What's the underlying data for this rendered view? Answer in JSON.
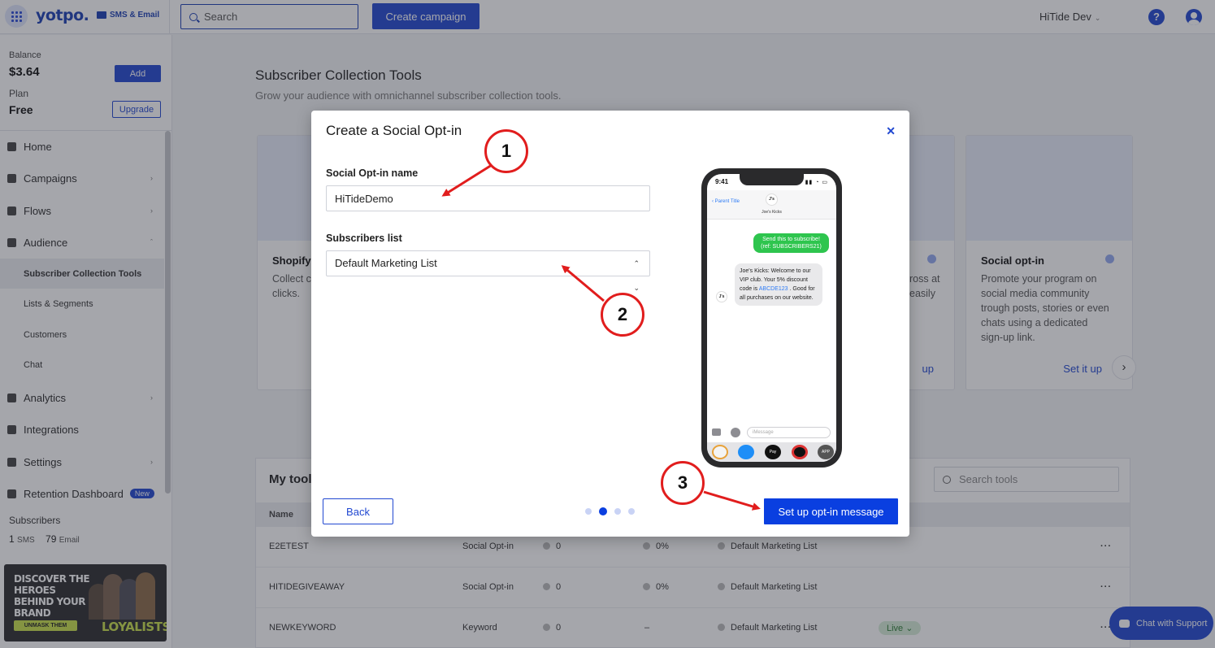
{
  "topbar": {
    "logo": "yotpo.",
    "product": "SMS & Email",
    "search_placeholder": "Search",
    "create_label": "Create campaign",
    "account_name": "HiTide Dev"
  },
  "sidebar": {
    "balance_label": "Balance",
    "balance_value": "$3.64",
    "add_label": "Add",
    "plan_label": "Plan",
    "plan_value": "Free",
    "upgrade_label": "Upgrade",
    "nav": [
      {
        "label": "Home"
      },
      {
        "label": "Campaigns"
      },
      {
        "label": "Flows"
      },
      {
        "label": "Audience"
      },
      {
        "label": "Analytics"
      },
      {
        "label": "Integrations"
      },
      {
        "label": "Settings"
      },
      {
        "label": "Retention Dashboard",
        "badge": "New"
      }
    ],
    "sub_nav": [
      {
        "label": "Subscriber Collection Tools"
      },
      {
        "label": "Lists & Segments"
      },
      {
        "label": "Customers"
      },
      {
        "label": "Chat"
      }
    ],
    "subscribers_label": "Subscribers",
    "sms_count": "1",
    "sms_unit": "SMS",
    "email_count": "79",
    "email_unit": "Email",
    "promo": {
      "headline": "DISCOVER THE HEROES BEHIND YOUR BRAND",
      "button": "UNMASK THEM",
      "brand": "LOYALISTS"
    }
  },
  "main": {
    "title": "Subscriber Collection Tools",
    "subtitle": "Grow your audience with omnichannel subscriber collection tools.",
    "cards": [
      {
        "title": "Shopify",
        "desc": "Collect c consent checkou clicks."
      },
      {
        "desc": "ross at easily",
        "link": "up"
      },
      {
        "title": "Social opt-in",
        "desc": "Promote your program on social media community trough posts, stories or even chats using a dedicated sign-up link.",
        "link": "Set it up"
      }
    ],
    "tools": {
      "title": "My tool",
      "search_placeholder": "Search tools",
      "col_name": "Name",
      "rows": [
        {
          "name": "E2ETEST",
          "type": "Social Opt-in",
          "subs": "0",
          "rate": "0%",
          "list": "Default Marketing List",
          "status": ""
        },
        {
          "name": "HITIDEGIVEAWAY",
          "type": "Social Opt-in",
          "subs": "0",
          "rate": "0%",
          "list": "Default Marketing List",
          "status": ""
        },
        {
          "name": "NEWKEYWORD",
          "type": "Keyword",
          "subs": "0",
          "rate": "–",
          "list": "Default Marketing List",
          "status": "Live"
        }
      ]
    },
    "chat_label": "Chat with Support"
  },
  "modal": {
    "title": "Create a Social Opt-in",
    "name_label": "Social Opt-in name",
    "name_value": "HiTideDemo",
    "list_label": "Subscribers list",
    "list_value": "Default Marketing List",
    "back_label": "Back",
    "primary_label": "Set up opt-in message",
    "page_total": 4,
    "page_current": 2,
    "phone": {
      "time": "9:41",
      "back_text": "Parent Title",
      "avatar": "J's",
      "contact": "Joe's Kicks",
      "outgoing": "Send this to subscribe! (ref: SUBSCRIBERS21)",
      "incoming_pre": "Joe's Kicks: Welcome to our VIP club. Your 5% discount code is",
      "incoming_code": "ABCDE123",
      "incoming_post": ". Good for all purchases on our website.",
      "input_placeholder": "iMessage",
      "apps": [
        "",
        "",
        "Pay",
        "",
        "APP"
      ]
    }
  },
  "annotations": [
    "1",
    "2",
    "3"
  ],
  "colors": {
    "brand": "#2148d1",
    "primary_button": "#0a3fe0",
    "annotation": "#e11d1d",
    "sms_green": "#2ec54e"
  }
}
